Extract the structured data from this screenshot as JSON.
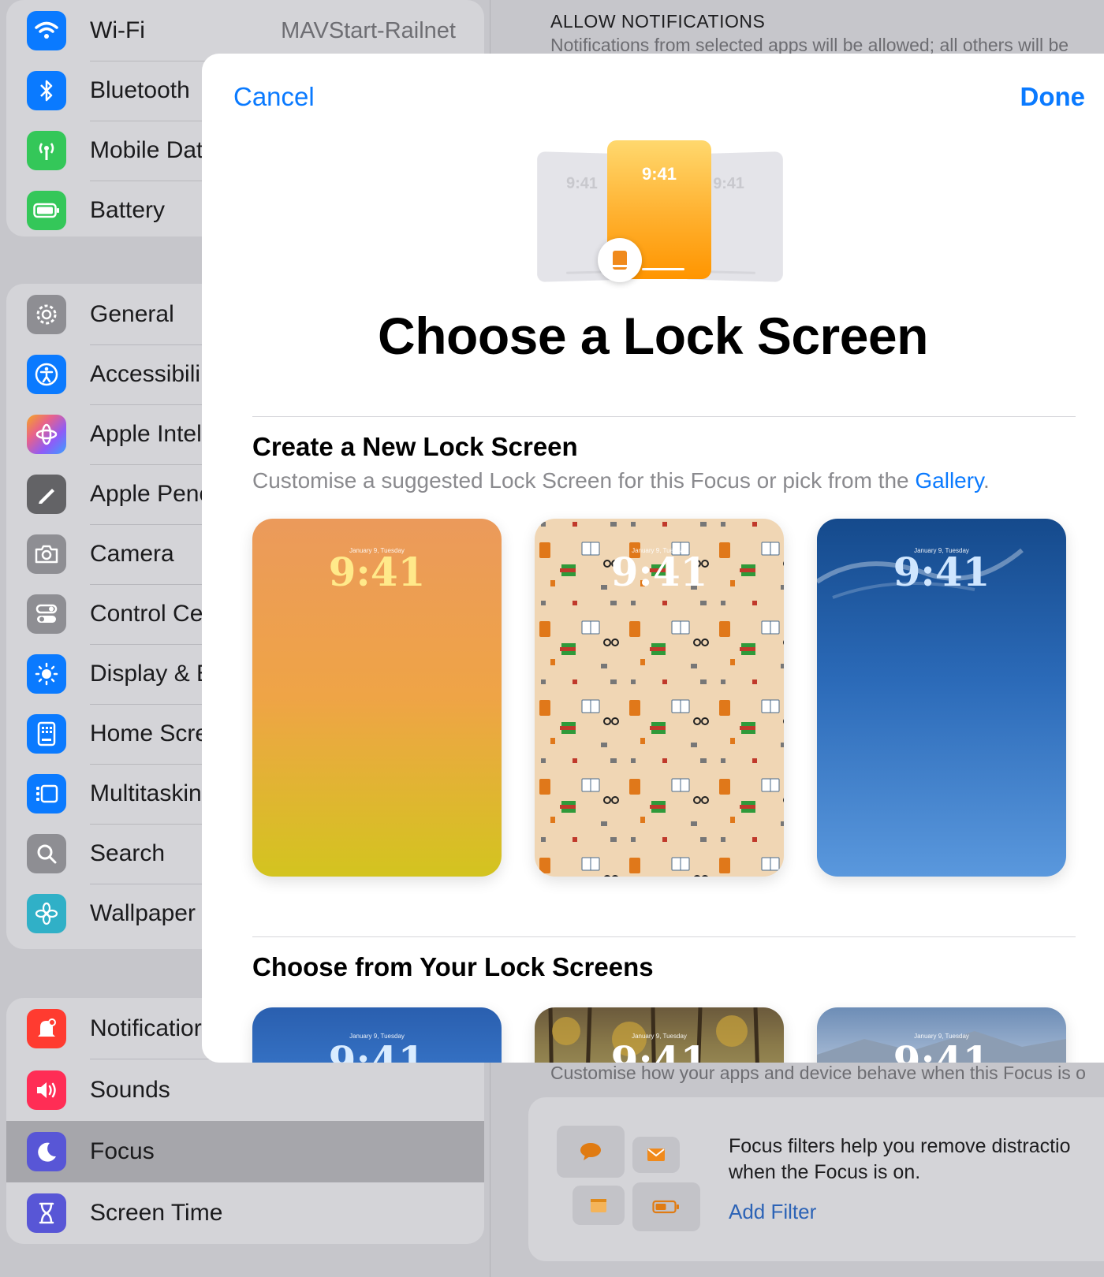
{
  "sidebar": {
    "group1": [
      {
        "label": "Wi-Fi",
        "value": "MAVStart-Railnet",
        "icon": "wifi-icon",
        "color": "#0a7aff"
      },
      {
        "label": "Bluetooth",
        "icon": "bluetooth-icon",
        "color": "#0a7aff"
      },
      {
        "label": "Mobile Dat",
        "icon": "antenna-icon",
        "color": "#34c759"
      },
      {
        "label": "Battery",
        "icon": "battery-icon",
        "color": "#34c759"
      }
    ],
    "group2": [
      {
        "label": "General",
        "icon": "gear-icon",
        "color": "#8e8e93"
      },
      {
        "label": "Accessibili",
        "icon": "accessibility-icon",
        "color": "#0a7aff"
      },
      {
        "label": "Apple Intel",
        "icon": "apple-intelligence-icon",
        "color": "#e8628a"
      },
      {
        "label": "Apple Penc",
        "icon": "pencil-icon",
        "color": "#636366"
      },
      {
        "label": "Camera",
        "icon": "camera-icon",
        "color": "#8e8e93"
      },
      {
        "label": "Control Ce",
        "icon": "toggles-icon",
        "color": "#8e8e93"
      },
      {
        "label": "Display & E",
        "icon": "sun-icon",
        "color": "#0a7aff"
      },
      {
        "label": "Home Scre",
        "icon": "home-screen-icon",
        "color": "#0a7aff"
      },
      {
        "label": "Multitaskin",
        "icon": "multitasking-icon",
        "color": "#0a7aff"
      },
      {
        "label": "Search",
        "icon": "search-icon",
        "color": "#8e8e93"
      },
      {
        "label": "Wallpaper",
        "icon": "flower-icon",
        "color": "#30b0c7"
      }
    ],
    "group3": [
      {
        "label": "Notificatior",
        "icon": "bell-icon",
        "color": "#ff3b30"
      },
      {
        "label": "Sounds",
        "icon": "speaker-icon",
        "color": "#ff2d55"
      },
      {
        "label": "Focus",
        "icon": "moon-icon",
        "color": "#5856d6"
      },
      {
        "label": "Screen Time",
        "icon": "hourglass-icon",
        "color": "#5856d6"
      }
    ]
  },
  "detail": {
    "allow_title": "ALLOW NOTIFICATIONS",
    "allow_sub": "Notifications from selected apps will be allowed; all others will be",
    "filters_sub": "Customise how your apps and device behave when this Focus is o",
    "filters_text_1": "Focus filters help you remove distractio",
    "filters_text_2": "when the Focus is on.",
    "add_filter": "Add Filter"
  },
  "sheet": {
    "cancel": "Cancel",
    "done": "Done",
    "hero_time": "9:41",
    "title": "Choose a Lock Screen",
    "create_title": "Create a New Lock Screen",
    "create_sub": "Customise a suggested Lock Screen for this Focus or pick from the ",
    "gallery_link": "Gallery",
    "period": ".",
    "choose_title": "Choose from Your Lock Screens",
    "lock_date": "January 9, Tuesday",
    "lock_time": "9:41"
  }
}
